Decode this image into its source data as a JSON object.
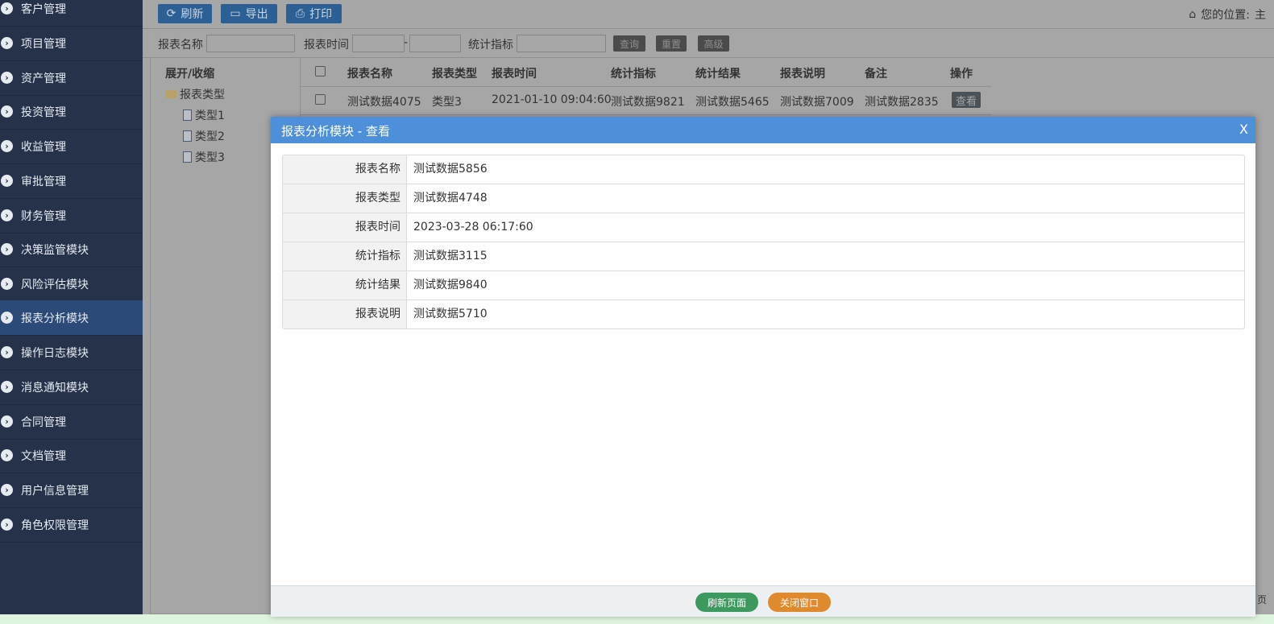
{
  "sidebar": {
    "items": [
      {
        "label": "客户管理"
      },
      {
        "label": "项目管理"
      },
      {
        "label": "资产管理"
      },
      {
        "label": "投资管理"
      },
      {
        "label": "收益管理"
      },
      {
        "label": "审批管理"
      },
      {
        "label": "财务管理"
      },
      {
        "label": "决策监管模块"
      },
      {
        "label": "风险评估模块"
      },
      {
        "label": "报表分析模块",
        "active": true
      },
      {
        "label": "操作日志模块"
      },
      {
        "label": "消息通知模块"
      },
      {
        "label": "合同管理"
      },
      {
        "label": "文档管理"
      },
      {
        "label": "用户信息管理"
      },
      {
        "label": "角色权限管理"
      }
    ]
  },
  "toolbar": {
    "refresh_label": "刷新",
    "export_label": "导出",
    "print_label": "打印",
    "location_label": "您的位置:",
    "location_value": "主"
  },
  "filter": {
    "name_label": "报表名称",
    "time_label": "报表时间",
    "range_sep": "-",
    "metric_label": "统计指标",
    "query_label": "查询",
    "reset_label": "重置",
    "advanced_label": "高级"
  },
  "tree": {
    "toggle_label": "展开/收缩",
    "root_label": "报表类型",
    "children": [
      "类型1",
      "类型2",
      "类型3"
    ]
  },
  "table": {
    "headers": [
      "报表名称",
      "报表类型",
      "报表时间",
      "统计指标",
      "统计结果",
      "报表说明",
      "备注",
      "操作"
    ],
    "rows": [
      {
        "name": "测试数据4075",
        "type": "类型3",
        "time": "2021-01-10 09:04:60",
        "metric": "测试数据9821",
        "result": "测试数据5465",
        "desc": "测试数据7009",
        "note": "测试数据2835",
        "action": "查看"
      }
    ]
  },
  "modal": {
    "title": "报表分析模块 - 查看",
    "close_label": "X",
    "fields": [
      {
        "label": "报表名称",
        "value": "测试数据5856"
      },
      {
        "label": "报表类型",
        "value": "测试数据4748"
      },
      {
        "label": "报表时间",
        "value": "2023-03-28 06:17:60"
      },
      {
        "label": "统计指标",
        "value": "测试数据3115"
      },
      {
        "label": "统计结果",
        "value": "测试数据9840"
      },
      {
        "label": "报表说明",
        "value": "测试数据5710"
      }
    ],
    "refresh_button": "刷新页面",
    "close_button": "关闭窗口"
  },
  "edge_text": "页"
}
